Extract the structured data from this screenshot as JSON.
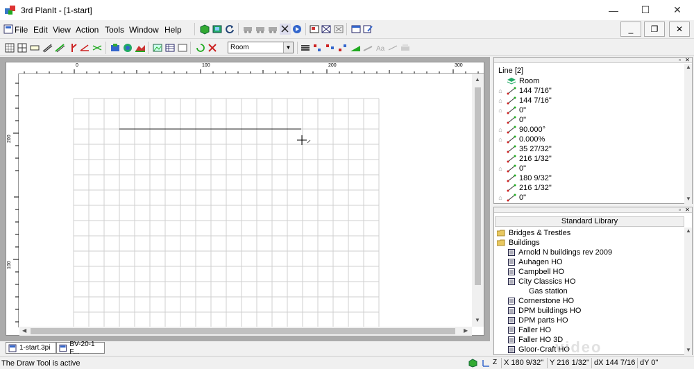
{
  "window": {
    "title": "3rd PlanIt - [1-start]",
    "minimize": "—",
    "maximize": "☐",
    "close": "✕"
  },
  "menu": {
    "items": [
      "File",
      "Edit",
      "View",
      "Action",
      "Tools",
      "Window",
      "Help"
    ],
    "mdi": {
      "minimize": "_",
      "restore": "❐",
      "close": "✕"
    }
  },
  "toolbar": {
    "layer_select_value": "Room"
  },
  "document": {
    "ruler_h_labels": [
      "0",
      "100",
      "200",
      "300"
    ],
    "ruler_v_labels": [
      "200",
      "100"
    ]
  },
  "tabs": [
    "1-start.3pi",
    "BV-20-1 F..."
  ],
  "status": {
    "text": "The Draw Tool is active",
    "axis_label": "Z",
    "x": "X 180 9/32\"",
    "y": "Y 216 1/32\"",
    "dx": "dX 144 7/16",
    "dy": "dY 0\""
  },
  "properties": {
    "title": "Line [2]",
    "rows": [
      {
        "icon": "layer-icon",
        "value": "Room",
        "locked": false
      },
      {
        "icon": "length-icon",
        "value": "144 7/16\"",
        "locked": true
      },
      {
        "icon": "dx-icon",
        "value": "144 7/16\"",
        "locked": true
      },
      {
        "icon": "dy-icon",
        "value": "0\"",
        "locked": true
      },
      {
        "icon": "dz-icon",
        "value": "0\"",
        "locked": false
      },
      {
        "icon": "angle-icon",
        "value": "90.000°",
        "locked": true
      },
      {
        "icon": "grade-icon",
        "value": "0.000%",
        "locked": true
      },
      {
        "icon": "start-x-icon",
        "value": "35 27/32\"",
        "locked": false
      },
      {
        "icon": "start-y-icon",
        "value": "216 1/32\"",
        "locked": false
      },
      {
        "icon": "start-z-icon",
        "value": "0\"",
        "locked": true
      },
      {
        "icon": "end-x-icon",
        "value": "180 9/32\"",
        "locked": false
      },
      {
        "icon": "end-y-icon",
        "value": "216 1/32\"",
        "locked": false
      },
      {
        "icon": "end-z-icon",
        "value": "0\"",
        "locked": true
      }
    ]
  },
  "library": {
    "title": "Standard Library",
    "items": [
      {
        "label": "Bridges & Trestles",
        "level": 0,
        "kind": "folder"
      },
      {
        "label": "Buildings",
        "level": 0,
        "kind": "folder"
      },
      {
        "label": "Arnold N buildings rev 2009",
        "level": 1,
        "kind": "book"
      },
      {
        "label": "Auhagen HO",
        "level": 1,
        "kind": "book"
      },
      {
        "label": "Campbell HO",
        "level": 1,
        "kind": "book"
      },
      {
        "label": "City Classics HO",
        "level": 1,
        "kind": "book"
      },
      {
        "label": "Gas station",
        "level": 2,
        "kind": "item"
      },
      {
        "label": "Cornerstone HO",
        "level": 1,
        "kind": "book"
      },
      {
        "label": "DPM buildings HO",
        "level": 1,
        "kind": "book"
      },
      {
        "label": "DPM parts HO",
        "level": 1,
        "kind": "book"
      },
      {
        "label": "Faller HO",
        "level": 1,
        "kind": "book"
      },
      {
        "label": "Faller HO 3D",
        "level": 1,
        "kind": "book"
      },
      {
        "label": "Gloor-Craft HO",
        "level": 1,
        "kind": "book"
      }
    ]
  },
  "watermark": "video"
}
